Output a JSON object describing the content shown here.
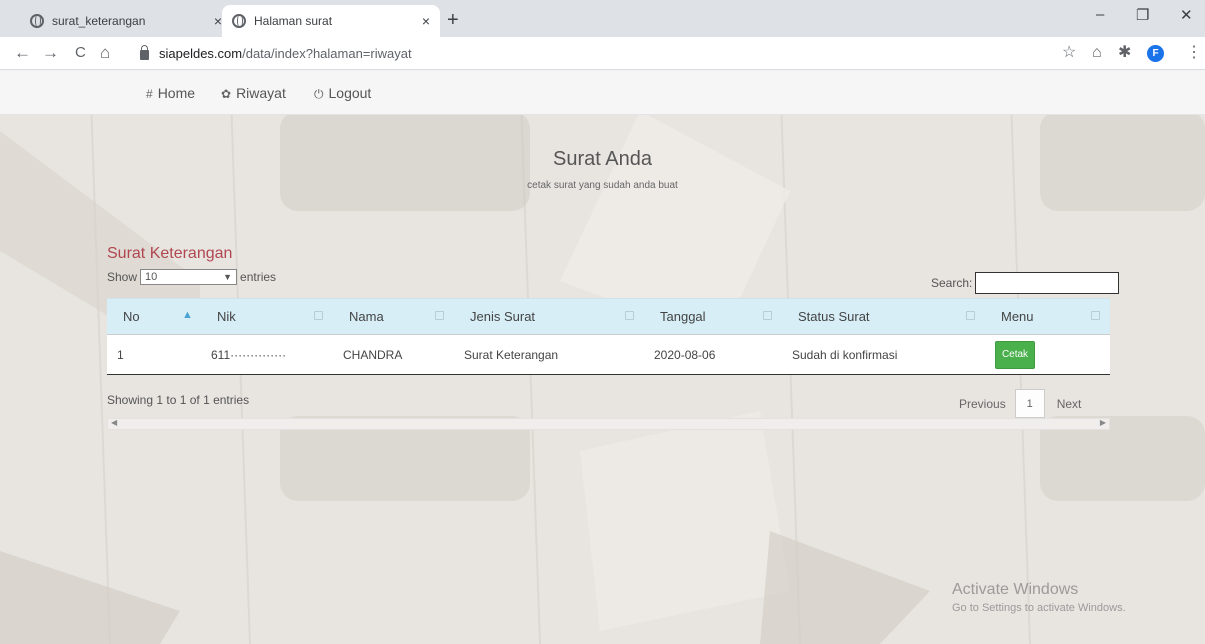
{
  "browser": {
    "tabs": [
      {
        "title": "surat_keterangan",
        "close": "×"
      },
      {
        "title": "Halaman surat",
        "close": "×"
      }
    ],
    "new_tab": "+",
    "window_controls": {
      "minimize": "–",
      "maximize": "❐",
      "close": "✕"
    },
    "nav": {
      "back": "←",
      "forward": "→",
      "reload": "C",
      "home": "⌂"
    },
    "url_host": "siapeldes.com",
    "url_path": "/data/index?halaman=riwayat",
    "toolbar_icons": {
      "star": "☆",
      "ext1": "⌂",
      "puzzle": "✱",
      "menu": "⋮"
    },
    "profile_initial": "F"
  },
  "navbar": {
    "items": [
      {
        "icon": "#",
        "label": "Home"
      },
      {
        "icon": "✿",
        "label": "Riwayat"
      },
      {
        "icon": "⏻",
        "label": "Logout"
      }
    ]
  },
  "hero": {
    "title": "Surat Anda",
    "subtitle": "cetak surat yang sudah anda buat"
  },
  "section": {
    "title": "Surat Keterangan"
  },
  "table_controls": {
    "show_label": "Show",
    "page_size": "10",
    "entries_label": "entries",
    "search_label": "Search:"
  },
  "table": {
    "columns": [
      "No",
      "Nik",
      "Nama",
      "Jenis Surat",
      "Tanggal",
      "Status Surat",
      "Menu"
    ],
    "rows": [
      {
        "no": "1",
        "nik": "611··············",
        "nama": "CHANDRA",
        "jenis": "Surat Keterangan",
        "tanggal": "2020-08-06",
        "status": "Sudah di konfirmasi",
        "action": "Cetak"
      }
    ]
  },
  "footer": {
    "info": "Showing 1 to 1 of 1 entries",
    "previous": "Previous",
    "page": "1",
    "next": "Next"
  },
  "watermark": {
    "line1": "Activate Windows",
    "line2": "Go to Settings to activate Windows."
  },
  "colors": {
    "accent_title": "#b0464f",
    "header_bg": "#d7eef7",
    "cetak_button": "#49b04b"
  }
}
